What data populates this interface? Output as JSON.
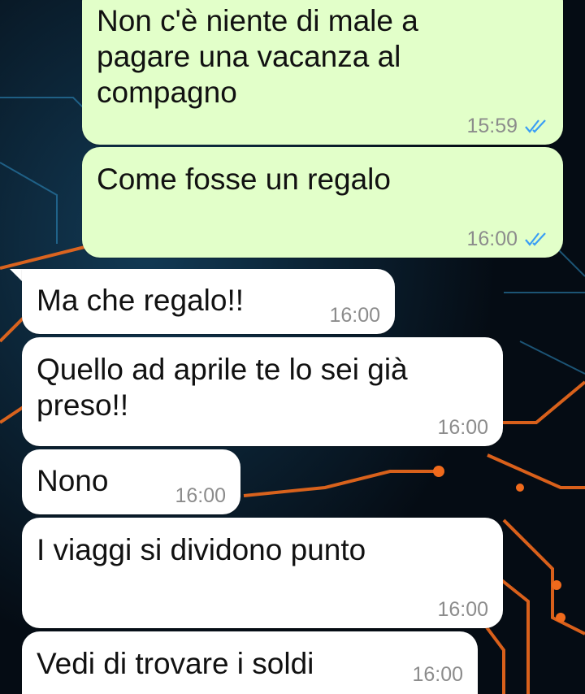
{
  "conversation": {
    "messages": [
      {
        "direction": "outgoing",
        "text": "Non c'è niente di male a\npagare una vacanza al\ncompagno",
        "time": "15:59",
        "status": "read-double-check-icon"
      },
      {
        "direction": "outgoing",
        "text": "Come fosse un regalo",
        "time": "16:00",
        "status": "read-double-check-icon"
      },
      {
        "direction": "incoming",
        "text": "Ma che regalo!!",
        "time": "16:00"
      },
      {
        "direction": "incoming",
        "text": "Quello ad aprile te lo sei già\npreso!!",
        "time": "16:00"
      },
      {
        "direction": "incoming",
        "text": "Nono",
        "time": "16:00"
      },
      {
        "direction": "incoming",
        "text": "I viaggi si dividono punto",
        "time": "16:00"
      },
      {
        "direction": "incoming",
        "text": "Vedi di trovare i soldi",
        "time": "16:00"
      }
    ]
  },
  "colors": {
    "outgoing_bubble": "#e2ffc9",
    "incoming_bubble": "#ffffff",
    "read_ticks": "#3a9ef5",
    "timestamp": "#8c8c8c",
    "wallpaper_base": "#07111c",
    "wallpaper_traces": "#f06a1c"
  }
}
